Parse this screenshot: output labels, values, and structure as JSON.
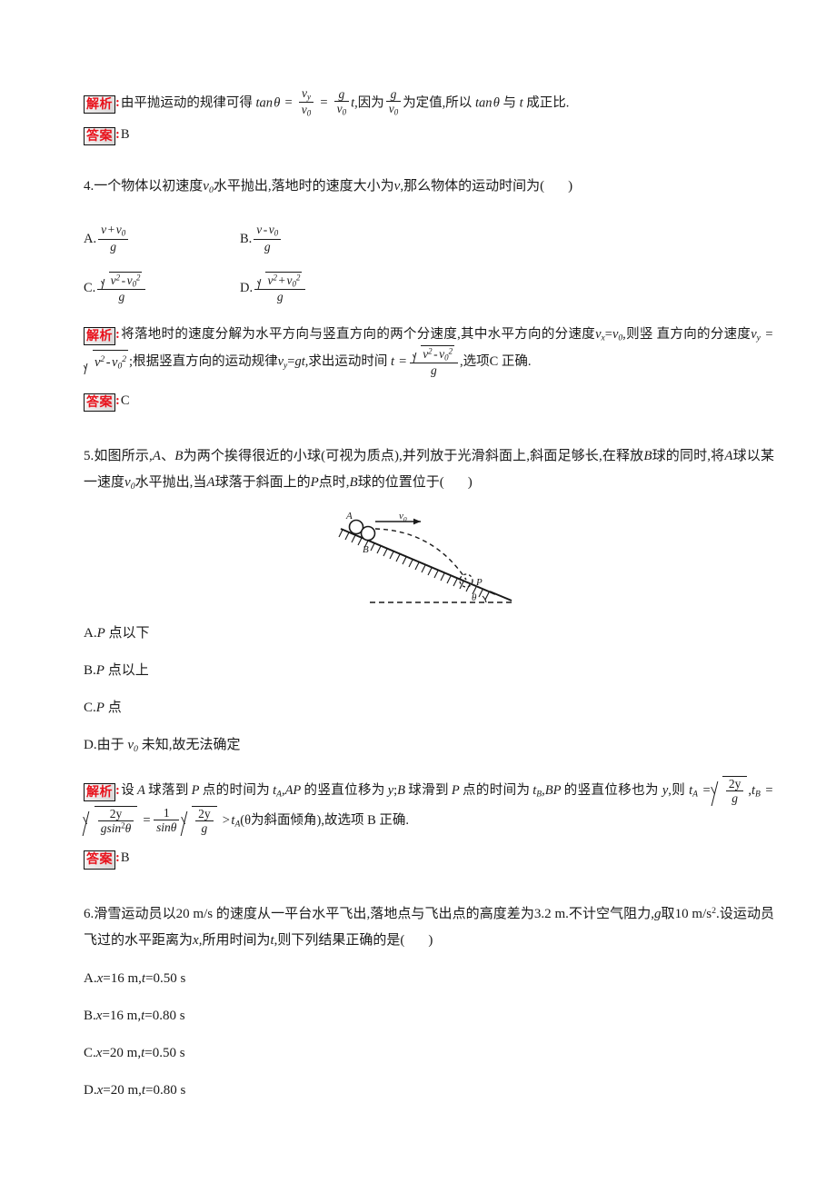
{
  "page": {
    "subject": "physics-worksheet",
    "tag_analysis": "解析",
    "tag_answer": "答案",
    "colon": ":"
  },
  "q3_solution": {
    "explain_prefix": "由平抛运动的规律可得",
    "tan": "tan",
    "theta": "θ",
    "eq": "=",
    "v_y": "v",
    "v_y_sub": "y",
    "v_0": "v",
    "v_0_sub": "0",
    "g": "g",
    "t": "t",
    "mid_text": ",因为",
    "mid_text2": "为定值,所以",
    "tail_text": "与",
    "tail_text2": "成正比.",
    "answer": "B"
  },
  "q4": {
    "number": "4.",
    "stem_a": "一个物体以初速度",
    "stem_v0": "v",
    "stem_v0_sub": "0",
    "stem_b": "水平抛出,落地时的速度大小为",
    "stem_v": "v",
    "stem_c": ",那么物体的运动时间为(",
    "stem_d": ")",
    "options": [
      {
        "label": "A.",
        "num_left": "v",
        "op": "+",
        "num_right": "v",
        "num_right_sub": "0",
        "den": "g"
      },
      {
        "label": "B.",
        "num_left": "v",
        "op": "-",
        "num_right": "v",
        "num_right_sub": "0",
        "den": "g"
      },
      {
        "label": "C.",
        "op": "-",
        "den": "g",
        "radicand_desc": "v²-v₀²"
      },
      {
        "label": "D.",
        "op": "+",
        "den": "g",
        "radicand_desc": "v²+v₀²"
      }
    ],
    "solution_line1": "将落地时的速度分解为水平方向与竖直方向的两个分速度,其中水平方向的分速度",
    "solution_vx": "v",
    "solution_vx_sub": "x",
    "solution_eq": "=",
    "solution_v0": "v",
    "solution_v0_sub": "0",
    "solution_line1_tail": ",则竖",
    "solution_line2_head": "直方向的分速度",
    "solution_vy": "v",
    "solution_vy_sub": "y",
    "solution_mid": ";根据竖直方向的运动规律",
    "solution_vy2": "v",
    "solution_vy2_sub": "y",
    "solution_gt": "gt",
    "solution_mid2": ",求出运动时间",
    "solution_t": "t",
    "solution_tail": ",选项C 正确.",
    "answer": "C"
  },
  "q5": {
    "number": "5.",
    "stem_line1_a": "如图所示,",
    "stem_A": "A",
    "stem_dun": "、",
    "stem_B": "B",
    "stem_line1_b": "为两个挨得很近的小球(可视为质点),并列放于光滑斜面上,斜面足够长,在释放",
    "stem_B2": "B",
    "stem_line1_c": "球",
    "stem_line2_a": "的同时,将",
    "stem_A2": "A",
    "stem_line2_b": "球以某一速度",
    "stem_v0": "v",
    "stem_v0_sub": "0",
    "stem_line2_c": "水平抛出,当",
    "stem_A3": "A",
    "stem_line2_d": "球落于斜面上的",
    "stem_P": "P",
    "stem_line2_e": "点时,",
    "stem_B3": "B",
    "stem_line2_f": "球的位置位于(",
    "stem_line2_g": ")",
    "figure": {
      "label_A": "A",
      "label_B": "B",
      "label_P": "P",
      "label_v0": "v",
      "label_v0_sub": "0",
      "label_theta": "θ"
    },
    "options": [
      {
        "label": "A.",
        "italic": "P",
        "text": " 点以下"
      },
      {
        "label": "B.",
        "italic": "P",
        "text": " 点以上"
      },
      {
        "label": "C.",
        "italic": "P",
        "text": " 点"
      },
      {
        "label": "D.",
        "italic": "",
        "text": "由于 v₀ 未知,故无法确定"
      }
    ],
    "solution_l1_a": "设",
    "solution_A": "A",
    "solution_l1_b": "球落到",
    "solution_P": "P",
    "solution_l1_c": "点的时间为",
    "solution_tA": "t",
    "solution_tA_sub": "A",
    "solution_l1_d": ",",
    "solution_AP": "AP",
    "solution_l1_e": "的竖直位移为",
    "solution_y": "y",
    "solution_l1_f": ";",
    "solution_B": "B",
    "solution_l1_g": "球滑到",
    "solution_P2": "P",
    "solution_l1_h": "点的时间为",
    "solution_tB": "t",
    "solution_tB_sub": "B",
    "solution_l1_i": ",",
    "solution_BP": "BP",
    "solution_l1_j": "的竖直位移也为",
    "solution_l2_a": "y",
    "solution_l2_b": ",则",
    "solution_2y": "2y",
    "solution_g": "g",
    "solution_gsin": "gsin",
    "solution_sup2": "2",
    "solution_theta": "θ",
    "solution_one": "1",
    "solution_sintheta": "sinθ",
    "solution_gt": ">",
    "solution_paren": "(θ为斜面倾角),故选项 B 正确.",
    "answer": "B"
  },
  "q6": {
    "number": "6.",
    "stem_line1": "滑雪运动员以20 m/s 的速度从一平台水平飞出,落地点与飞出点的高度差为3.2 m.不计空气阻力,",
    "stem_g": "g",
    "stem_line2_a": "取10 m/s",
    "stem_line2_sup": "2",
    "stem_line2_b": ".设运动员飞过的水平距离为",
    "stem_x": "x",
    "stem_line2_c": ",所用时间为",
    "stem_t": "t",
    "stem_line2_d": ",则下列结果正确的是(",
    "stem_line2_e": ")",
    "options": [
      {
        "label": "A.",
        "x_var": "x",
        "x_val": "=16 m,",
        "t_var": "t",
        "t_val": "=0.50 s"
      },
      {
        "label": "B.",
        "x_var": "x",
        "x_val": "=16 m,",
        "t_var": "t",
        "t_val": "=0.80 s"
      },
      {
        "label": "C.",
        "x_var": "x",
        "x_val": "=20 m,",
        "t_var": "t",
        "t_val": "=0.50 s"
      },
      {
        "label": "D.",
        "x_var": "x",
        "x_val": "=20 m,",
        "t_var": "t",
        "t_val": "=0.80 s"
      }
    ]
  }
}
